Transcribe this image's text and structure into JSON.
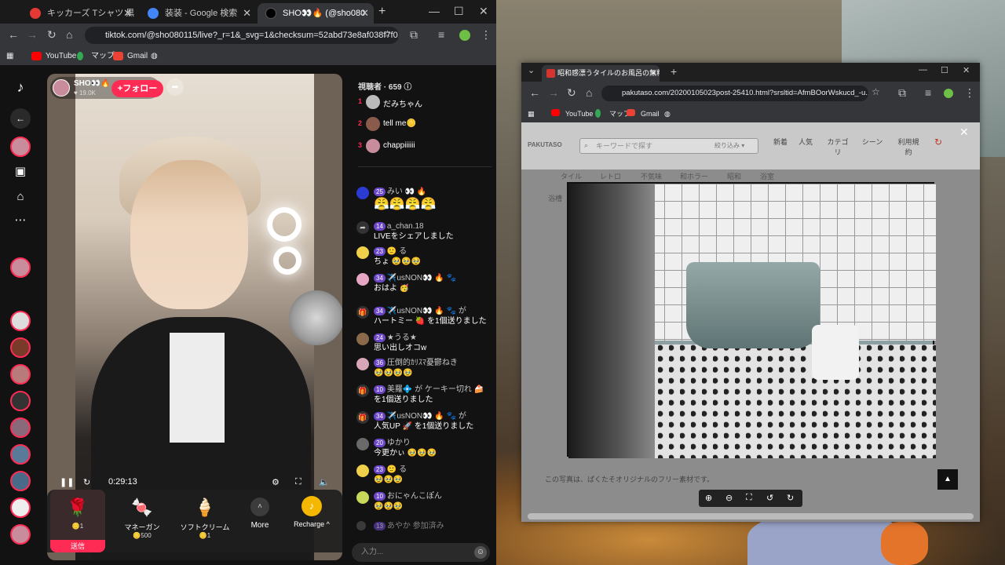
{
  "left_browser": {
    "tabs": [
      {
        "title": "キッカーズ Tシャツ 黒 - メルカリ",
        "favicon_color": "#e53935"
      },
      {
        "title": "装装 - Google 検索",
        "favicon_color": "#4285f4"
      },
      {
        "title": "SHO👀🔥 (@sho080",
        "favicon_color": "#000000"
      }
    ],
    "url": "tiktok.com/@sho080115/live?_r=1&_svg=1&checksum=52abd73e8af038f7f0...",
    "bookmarks": [
      "YouTube",
      "マップ",
      "Gmail"
    ]
  },
  "tiktok": {
    "streamer": {
      "name": "SHO👀🔥",
      "likes": "♥ 19.0K",
      "follow_label": "+フォロー"
    },
    "video": {
      "time": "0:29:13"
    },
    "gifts": [
      {
        "icon": "🌹",
        "name": "",
        "price": "🪙1",
        "send": "送信"
      },
      {
        "icon": "🍬",
        "name": "マネーガン",
        "price": "🪙500"
      },
      {
        "icon": "🍦",
        "name": "ソフトクリーム",
        "price": "🪙1"
      },
      {
        "icon": "˄",
        "name": "More",
        "price": ""
      },
      {
        "icon": "♪",
        "name": "Recharge ^",
        "price": ""
      }
    ],
    "chat": {
      "viewers": "視聴者 · 659 ⓘ",
      "ranking": [
        {
          "rank": "1",
          "name": "だみちゃん"
        },
        {
          "rank": "2",
          "name": "tell me🪙"
        },
        {
          "rank": "3",
          "name": "chappiiiiii"
        }
      ],
      "messages": [
        {
          "level": "25",
          "user": "みい 👀 🔥",
          "text": "😤😤😤😤"
        },
        {
          "level": "14",
          "user": "a_chan.18",
          "text": "LIVEをシェアしました"
        },
        {
          "level": "23",
          "user": "🙂 る",
          "text": "ちょ 🥹🥹🥹"
        },
        {
          "level": "34",
          "user": "✈️usNON👀 🔥 🐾",
          "text": "おはよ 🥳"
        },
        {
          "level": "34",
          "user": "✈️usNON👀 🔥 🐾 が",
          "text": "ハートミー 🍓 を1個送りました"
        },
        {
          "level": "24",
          "user": "★うる★",
          "text": "思い出しオコw"
        },
        {
          "level": "36",
          "user": "圧倒的ｶﾘｽﾏ憂鬱ねき",
          "text": "🥹🥹🥹🥹"
        },
        {
          "level": "10",
          "user": "美羅💠 が ケーキー切れ 🍰",
          "text": "を1個送りました"
        },
        {
          "level": "34",
          "user": "✈️usNON👀 🔥 🐾 が",
          "text": "人気UP 🚀 を1個送りました"
        },
        {
          "level": "20",
          "user": "ゆかり",
          "text": "今更かぃ 🥹🥹🥹"
        },
        {
          "level": "23",
          "user": "🙂 る",
          "text": "🥹🥹🥹"
        },
        {
          "level": "10",
          "user": "おにゃんこぽん",
          "text": "🥹🥹🥹"
        },
        {
          "level": "13",
          "user": "あやか 参加済み",
          "text": ""
        }
      ],
      "input_placeholder": "入力..."
    }
  },
  "right_browser": {
    "tab_title": "昭和感漂うタイルのお風呂の無料",
    "url": "pakutaso.com/20200105023post-25410.html?srsltid=AfmBOorWskucd_-u...",
    "bookmarks": [
      "YouTube",
      "マップ",
      "Gmail"
    ],
    "site": {
      "search_placeholder": "キーワードで探す",
      "filter": "絞り込み ▾",
      "nav": [
        "新着",
        "人気",
        "カテゴリ",
        "シーン",
        "利用規約"
      ],
      "tags": [
        "タイル",
        "レトロ",
        "不気味",
        "和ホラー",
        "昭和",
        "浴室"
      ],
      "tag_extra": "浴槽",
      "note": "この写真は、ぱくたそオリジナルのフリー素材です。"
    }
  }
}
